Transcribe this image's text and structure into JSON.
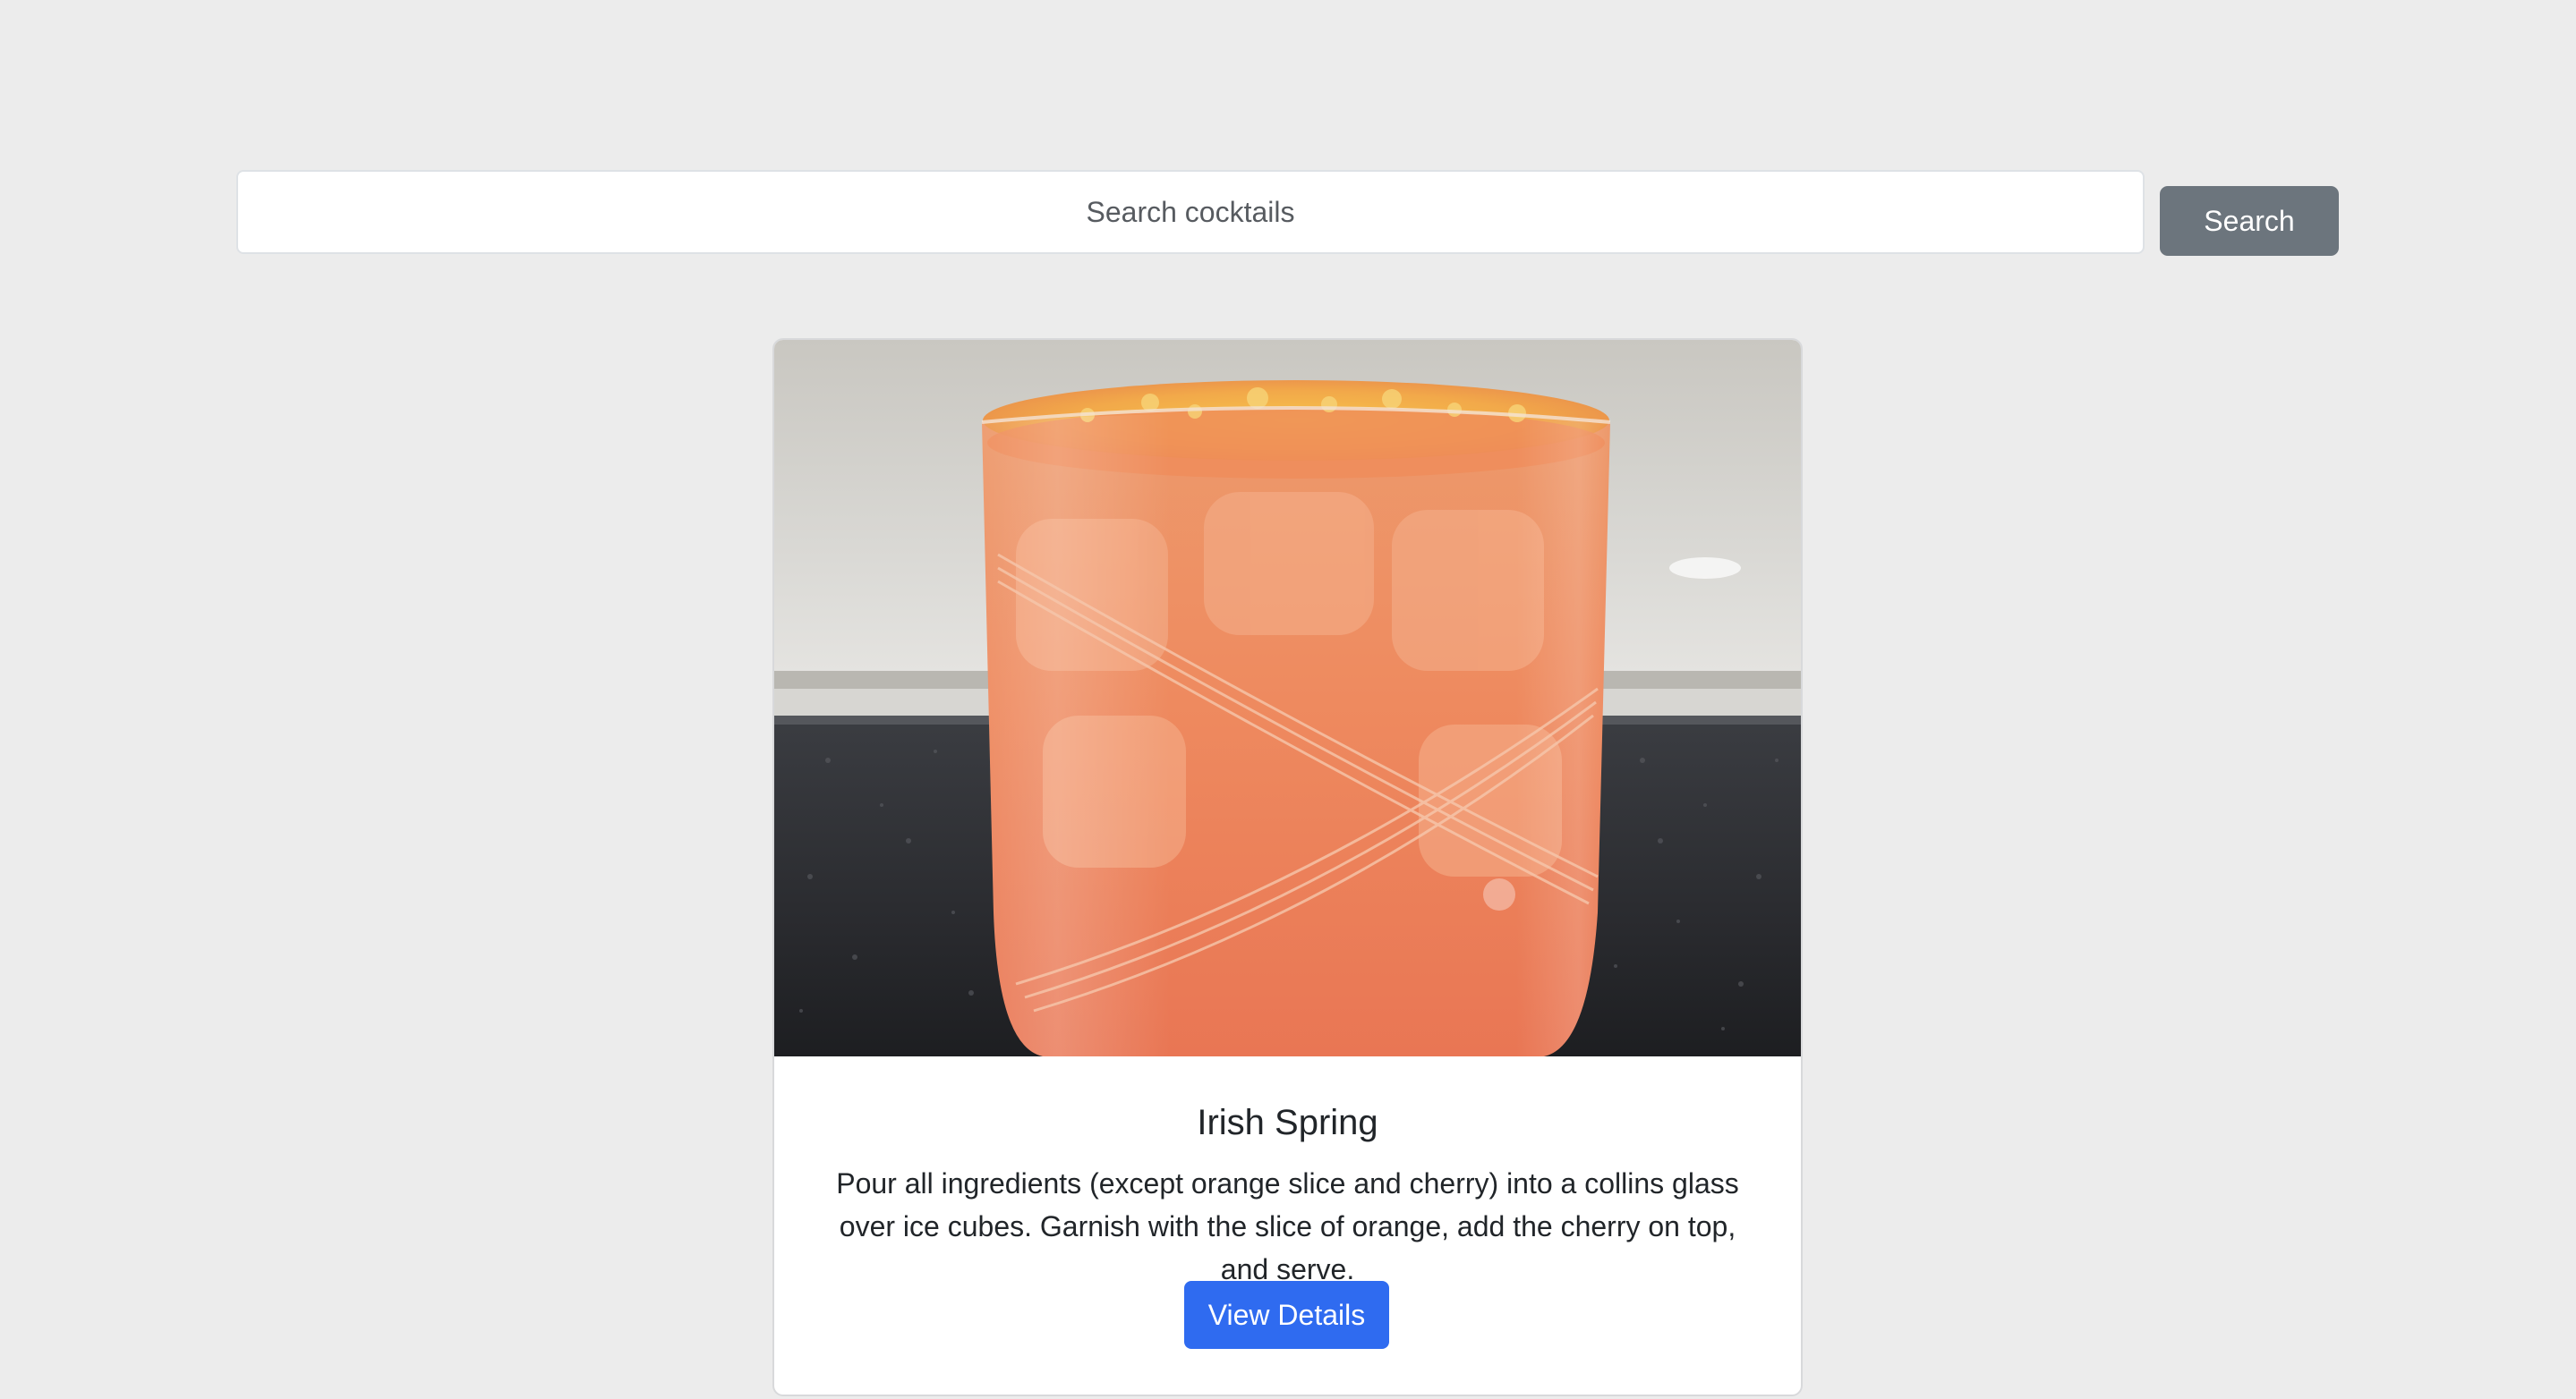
{
  "search": {
    "placeholder": "Search cocktails",
    "value": "",
    "button_label": "Search"
  },
  "card": {
    "image_subject": "orange cocktail in etched glass with ice",
    "title": "Irish Spring",
    "description": "Pour all ingredients (except orange slice and cherry) into a collins glass over ice cubes. Garnish with the slice of orange, add the cherry on top, and serve.",
    "button_label": "View Details"
  },
  "colors": {
    "background": "#ececec",
    "search_button": "#6c757d",
    "details_button": "#2f6bf0",
    "card_background": "#ffffff",
    "drink": "#ef8a61"
  }
}
